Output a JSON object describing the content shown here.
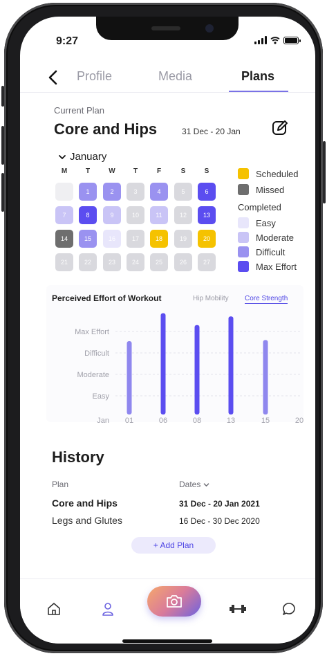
{
  "status_bar": {
    "time": "9:27"
  },
  "tabs": [
    {
      "label": "Profile",
      "active": false
    },
    {
      "label": "Media",
      "active": false
    },
    {
      "label": "Plans",
      "active": true
    }
  ],
  "current_plan": {
    "label": "Current Plan",
    "name": "Core and Hips",
    "dates": "31 Dec - 20 Jan"
  },
  "calendar": {
    "month": "January",
    "weekdays": [
      "M",
      "T",
      "W",
      "T",
      "F",
      "S",
      "S"
    ],
    "days": [
      {
        "label": "",
        "status": "empty"
      },
      {
        "label": "1",
        "status": "difficult"
      },
      {
        "label": "2",
        "status": "difficult"
      },
      {
        "label": "3",
        "status": "future"
      },
      {
        "label": "4",
        "status": "difficult"
      },
      {
        "label": "5",
        "status": "future"
      },
      {
        "label": "6",
        "status": "max"
      },
      {
        "label": "7",
        "status": "moderate"
      },
      {
        "label": "8",
        "status": "max"
      },
      {
        "label": "9",
        "status": "moderate"
      },
      {
        "label": "10",
        "status": "future"
      },
      {
        "label": "11",
        "status": "moderate"
      },
      {
        "label": "12",
        "status": "future"
      },
      {
        "label": "13",
        "status": "max"
      },
      {
        "label": "14",
        "status": "missed"
      },
      {
        "label": "15",
        "status": "difficult"
      },
      {
        "label": "16",
        "status": "easy"
      },
      {
        "label": "17",
        "status": "future"
      },
      {
        "label": "18",
        "status": "scheduled"
      },
      {
        "label": "19",
        "status": "future"
      },
      {
        "label": "20",
        "status": "scheduled"
      },
      {
        "label": "21",
        "status": "future"
      },
      {
        "label": "22",
        "status": "future"
      },
      {
        "label": "23",
        "status": "future"
      },
      {
        "label": "24",
        "status": "future"
      },
      {
        "label": "25",
        "status": "future"
      },
      {
        "label": "26",
        "status": "future"
      },
      {
        "label": "27",
        "status": "future"
      }
    ]
  },
  "legend": {
    "scheduled": "Scheduled",
    "missed": "Missed",
    "completed_heading": "Completed",
    "easy": "Easy",
    "moderate": "Moderate",
    "difficult": "Difficult",
    "max_effort": "Max Effort"
  },
  "colors": {
    "accent": "#4f46e5",
    "scheduled": "#f5c200",
    "missed": "#6e6e6e",
    "easy": "#e8e6fb",
    "moderate": "#c9c4f6",
    "difficult": "#9a92f0",
    "max_effort": "#5b4df0",
    "future": "#d9d9de",
    "empty": "#efeff2"
  },
  "effort_chart": {
    "title": "Perceived Effort of Workout",
    "tabs": [
      {
        "label": "Hip Mobility",
        "active": false
      },
      {
        "label": "Core Strength",
        "active": true
      }
    ]
  },
  "chart_data": {
    "type": "bar",
    "categories": [
      "01",
      "06",
      "08",
      "13",
      "15",
      "20"
    ],
    "values": [
      3.55,
      4.85,
      4.3,
      4.7,
      3.6,
      null
    ],
    "y_labels": [
      "Easy",
      "Moderate",
      "Difficult",
      "Max Effort"
    ],
    "x_axis_label": "Jan",
    "ylim": [
      0,
      5
    ],
    "grid": true
  },
  "history": {
    "title": "History",
    "col_plan": "Plan",
    "col_dates": "Dates",
    "rows": [
      {
        "plan": "Core and Hips",
        "dates": "31 Dec - 20 Jan 2021"
      },
      {
        "plan": "Legs and Glutes",
        "dates": "16 Dec - 30 Dec 2020"
      }
    ],
    "add_plan": "+ Add Plan"
  },
  "tabbar": {
    "icons": [
      "home-icon",
      "profile-icon",
      "camera-icon",
      "dumbbell-icon",
      "chat-icon"
    ]
  }
}
